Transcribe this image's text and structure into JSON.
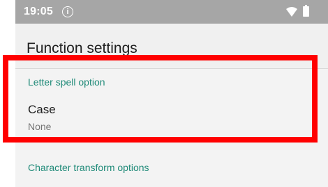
{
  "status_bar": {
    "time": "19:05",
    "info_icon": "info-icon",
    "wifi_icon": "wifi-icon",
    "battery_icon": "battery-icon"
  },
  "app_bar": {
    "title": "Function settings"
  },
  "categories": [
    {
      "title": "Letter spell option",
      "items": [
        {
          "title": "Case",
          "summary": "None"
        }
      ]
    },
    {
      "title": "Character transform options"
    }
  ],
  "colors": {
    "accent": "#1f8a78",
    "status_bar": "#a6a6a6",
    "highlight": "#ff0000"
  }
}
